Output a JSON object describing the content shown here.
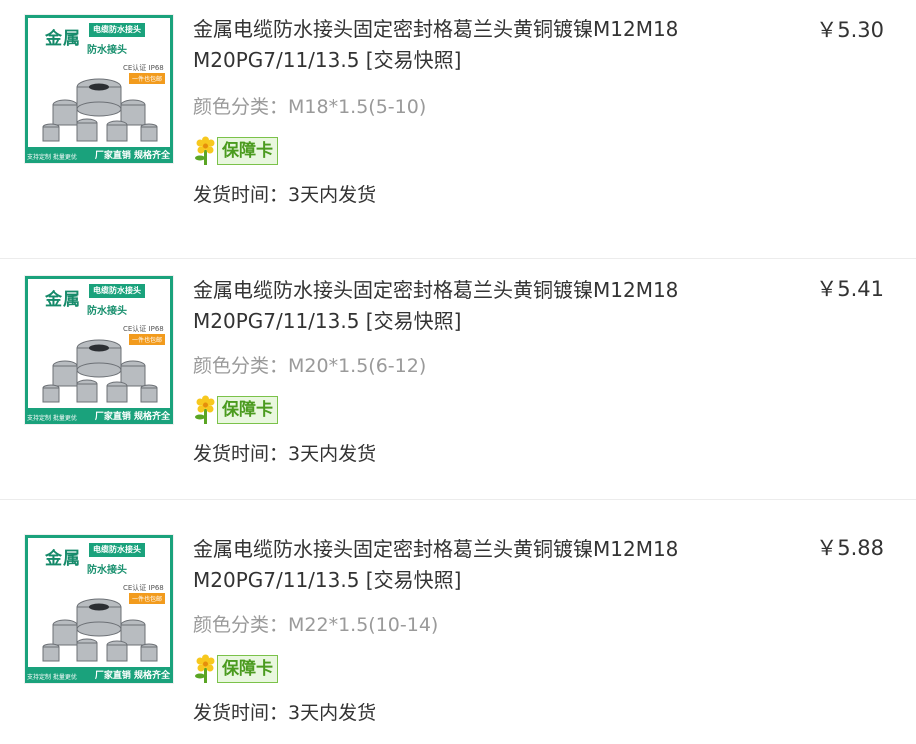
{
  "items": [
    {
      "title": "金属电缆防水接头固定密封格葛兰头黄铜镀镍M12M18 M20PG7/11/13.5 [交易快照]",
      "spec_label": "颜色分类：",
      "spec_value": "M18*1.5(5-10)",
      "guarantee": "保障卡",
      "ship_label": "发货时间：",
      "ship_value": "3天内发货",
      "price": "￥5.30",
      "thumb": {
        "brand": "金属",
        "tagline": "电缆防水接头",
        "subtitle": "防水接头",
        "cert": "CE认证 IP68",
        "badge": "一件也包邮",
        "bottom_left": "支持定制 批量更优",
        "bottom_right": "厂家直销 规格齐全"
      }
    },
    {
      "title": "金属电缆防水接头固定密封格葛兰头黄铜镀镍M12M18 M20PG7/11/13.5 [交易快照]",
      "spec_label": "颜色分类：",
      "spec_value": "M20*1.5(6-12)",
      "guarantee": "保障卡",
      "ship_label": "发货时间：",
      "ship_value": "3天内发货",
      "price": "￥5.41",
      "thumb": {
        "brand": "金属",
        "tagline": "电缆防水接头",
        "subtitle": "防水接头",
        "cert": "CE认证 IP68",
        "badge": "一件也包邮",
        "bottom_left": "支持定制 批量更优",
        "bottom_right": "厂家直销 规格齐全"
      }
    },
    {
      "title": "金属电缆防水接头固定密封格葛兰头黄铜镀镍M12M18 M20PG7/11/13.5 [交易快照]",
      "spec_label": "颜色分类：",
      "spec_value": "M22*1.5(10-14)",
      "guarantee": "保障卡",
      "ship_label": "发货时间：",
      "ship_value": "3天内发货",
      "price": "￥5.88",
      "thumb": {
        "brand": "金属",
        "tagline": "电缆防水接头",
        "subtitle": "防水接头",
        "cert": "CE认证 IP68",
        "badge": "一件也包邮",
        "bottom_left": "支持定制 批量更优",
        "bottom_right": "厂家直销 规格齐全"
      }
    }
  ],
  "colors": {
    "brand_green": "#1aa27c",
    "guarantee_green": "#4b9b1f",
    "muted_text": "#9a9a9a",
    "body_text": "#333333"
  },
  "icons": {
    "guarantee": "yellow-flower-icon"
  }
}
